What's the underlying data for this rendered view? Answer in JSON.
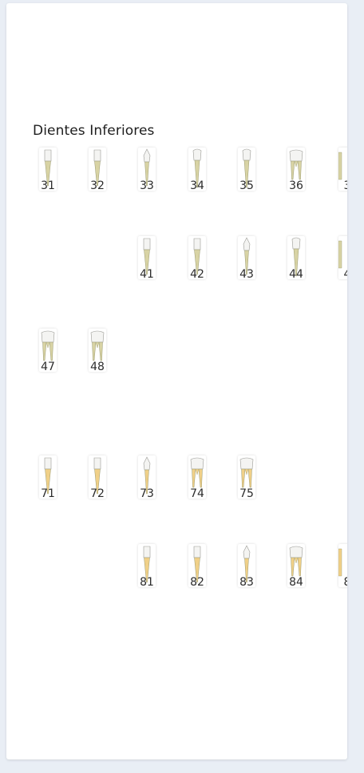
{
  "section": {
    "title": "Dientes Inferiores"
  },
  "rows": [
    {
      "teeth": [
        {
          "num": "31",
          "type": "incisor",
          "color": "#d8d3a4"
        },
        {
          "num": "32",
          "type": "incisor",
          "color": "#d8d3a4"
        },
        {
          "num": "33",
          "type": "canine",
          "color": "#d8d3a4"
        },
        {
          "num": "34",
          "type": "premolar",
          "color": "#d8d3a4"
        },
        {
          "num": "35",
          "type": "premolar",
          "color": "#d8d3a4"
        },
        {
          "num": "36",
          "type": "molar",
          "color": "#d8d3a4"
        },
        {
          "num": "3",
          "type": "partial",
          "color": "#d8d3a4"
        }
      ]
    },
    {
      "teeth": [
        {
          "num": "41",
          "type": "incisor",
          "color": "#d8d3a4"
        },
        {
          "num": "42",
          "type": "incisor",
          "color": "#d8d3a4"
        },
        {
          "num": "43",
          "type": "canine",
          "color": "#d8d3a4"
        },
        {
          "num": "44",
          "type": "premolar",
          "color": "#d8d3a4"
        },
        {
          "num": "4",
          "type": "partial",
          "color": "#d8d3a4"
        }
      ]
    },
    {
      "teeth": [
        {
          "num": "47",
          "type": "molar",
          "color": "#d8d3a4"
        },
        {
          "num": "48",
          "type": "molar",
          "color": "#d8d3a4"
        }
      ]
    },
    {
      "teeth": [
        {
          "num": "71",
          "type": "incisor",
          "color": "#f0d088"
        },
        {
          "num": "72",
          "type": "incisor",
          "color": "#f0d088"
        },
        {
          "num": "73",
          "type": "canine",
          "color": "#f0d088"
        },
        {
          "num": "74",
          "type": "molar",
          "color": "#f0d088"
        },
        {
          "num": "75",
          "type": "molar",
          "color": "#f0d088"
        }
      ]
    },
    {
      "teeth": [
        {
          "num": "81",
          "type": "incisor",
          "color": "#f0d088"
        },
        {
          "num": "82",
          "type": "incisor",
          "color": "#f0d088"
        },
        {
          "num": "83",
          "type": "canine",
          "color": "#f0d088"
        },
        {
          "num": "84",
          "type": "molar",
          "color": "#f0d088"
        },
        {
          "num": "8",
          "type": "partial",
          "color": "#f0d088"
        }
      ]
    }
  ]
}
